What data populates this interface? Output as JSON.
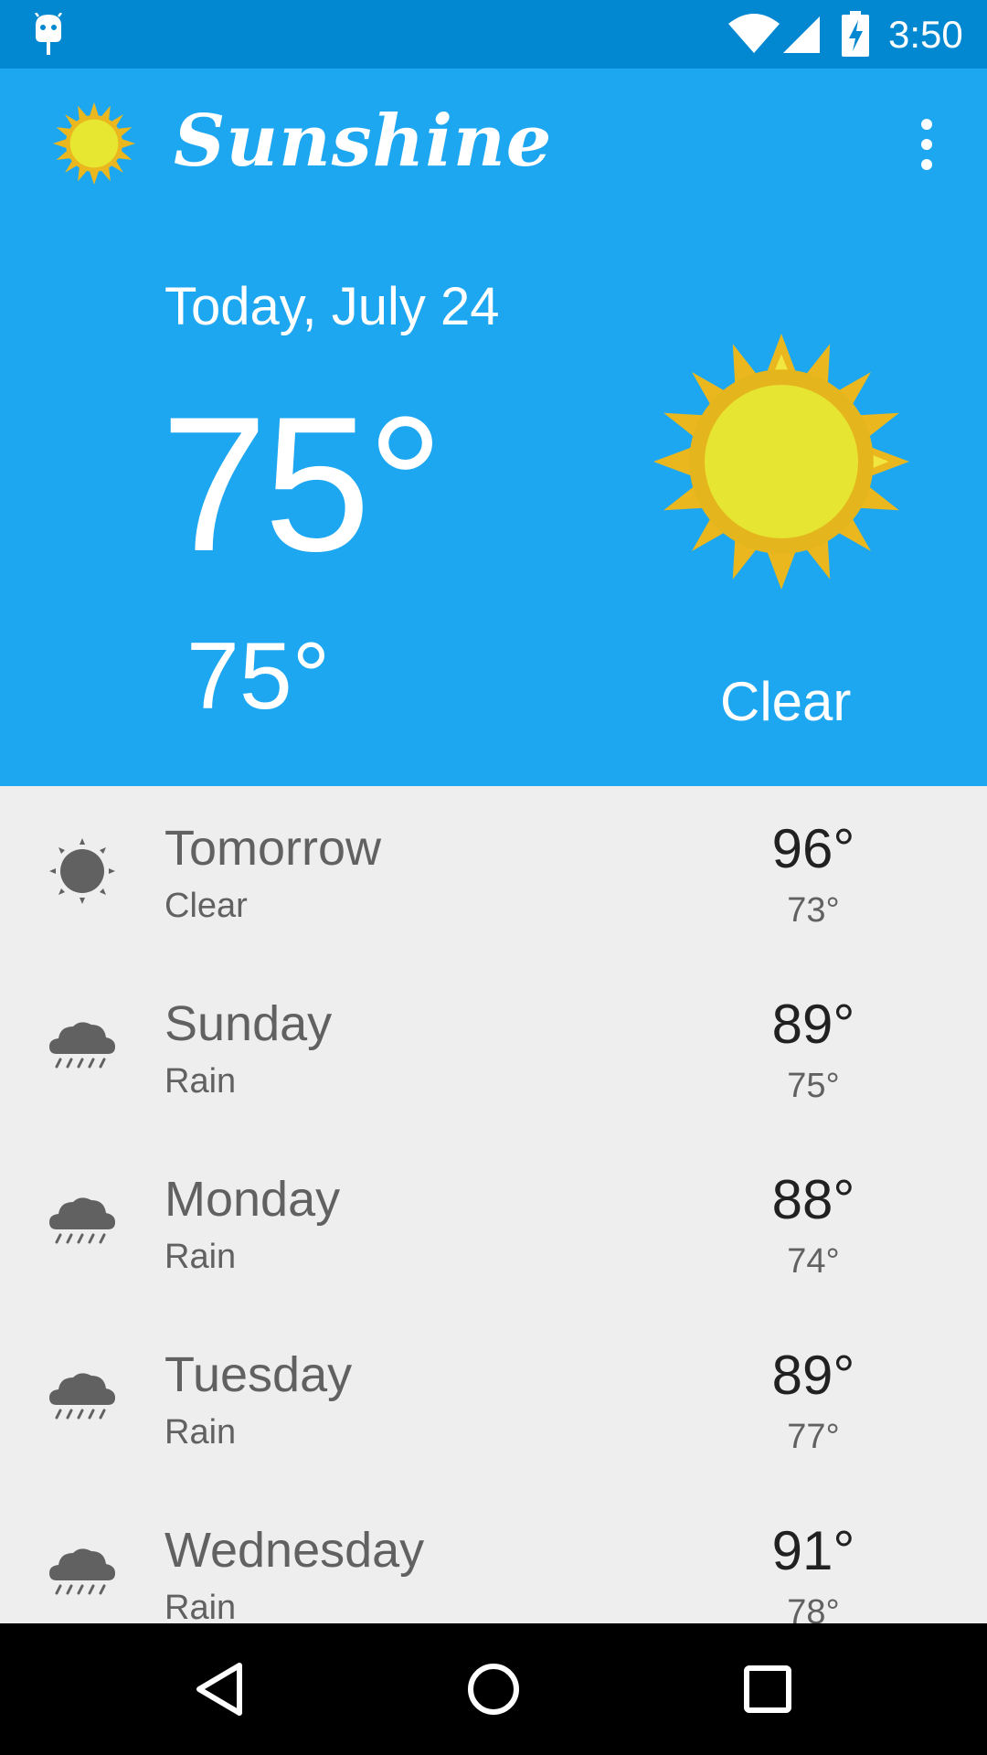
{
  "status_bar": {
    "time": "3:50",
    "icons": [
      "android-debug-icon",
      "wifi-icon",
      "signal-icon",
      "battery-charging-icon"
    ]
  },
  "app_bar": {
    "title": "Sunshine",
    "logo_icon": "sun-icon",
    "menu_icon": "overflow-menu-icon"
  },
  "today": {
    "date": "Today, July 24",
    "high": "75°",
    "low": "75°",
    "description": "Clear",
    "art_icon": "sun-art-icon"
  },
  "forecast": [
    {
      "day": "Tomorrow",
      "condition": "Clear",
      "high": "96°",
      "low": "73°",
      "icon": "clear-icon"
    },
    {
      "day": "Sunday",
      "condition": "Rain",
      "high": "89°",
      "low": "75°",
      "icon": "rain-icon"
    },
    {
      "day": "Monday",
      "condition": "Rain",
      "high": "88°",
      "low": "74°",
      "icon": "rain-icon"
    },
    {
      "day": "Tuesday",
      "condition": "Rain",
      "high": "89°",
      "low": "77°",
      "icon": "rain-icon"
    },
    {
      "day": "Wednesday",
      "condition": "Rain",
      "high": "91°",
      "low": "78°",
      "icon": "rain-icon"
    }
  ],
  "nav_bar": {
    "icons": [
      "back-icon",
      "home-icon",
      "recents-icon"
    ]
  },
  "colors": {
    "status_bar": "#0288d1",
    "header": "#1ea7f1",
    "list_background": "#eeeeee",
    "sun_yellow": "#e7e732",
    "sun_orange": "#eab71e"
  }
}
